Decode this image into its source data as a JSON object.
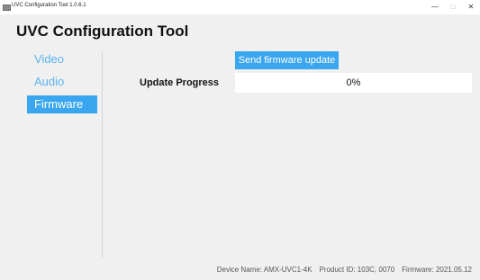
{
  "window": {
    "title": "UVC Configuration Tool 1.0.6.1",
    "minimize_label": "—",
    "maximize_label": "□",
    "close_label": "✕"
  },
  "app": {
    "title": "UVC Configuration Tool"
  },
  "sidebar": {
    "items": [
      {
        "label": "Video",
        "active": false
      },
      {
        "label": "Audio",
        "active": false
      },
      {
        "label": "Firmware",
        "active": true
      }
    ]
  },
  "firmware": {
    "send_button_label": "Send firmware update",
    "progress_label": "Update Progress",
    "progress_text": "0%",
    "progress_value": 0
  },
  "status": {
    "device_name": "Device Name: AMX-UVC1-4K",
    "product_id": "Product ID: 103C, 0070",
    "firmware": "Firmware: 2021.05.12"
  },
  "colors": {
    "accent": "#3aa6f0",
    "nav_text": "#5ab4ef",
    "background": "#f0f0f0"
  }
}
